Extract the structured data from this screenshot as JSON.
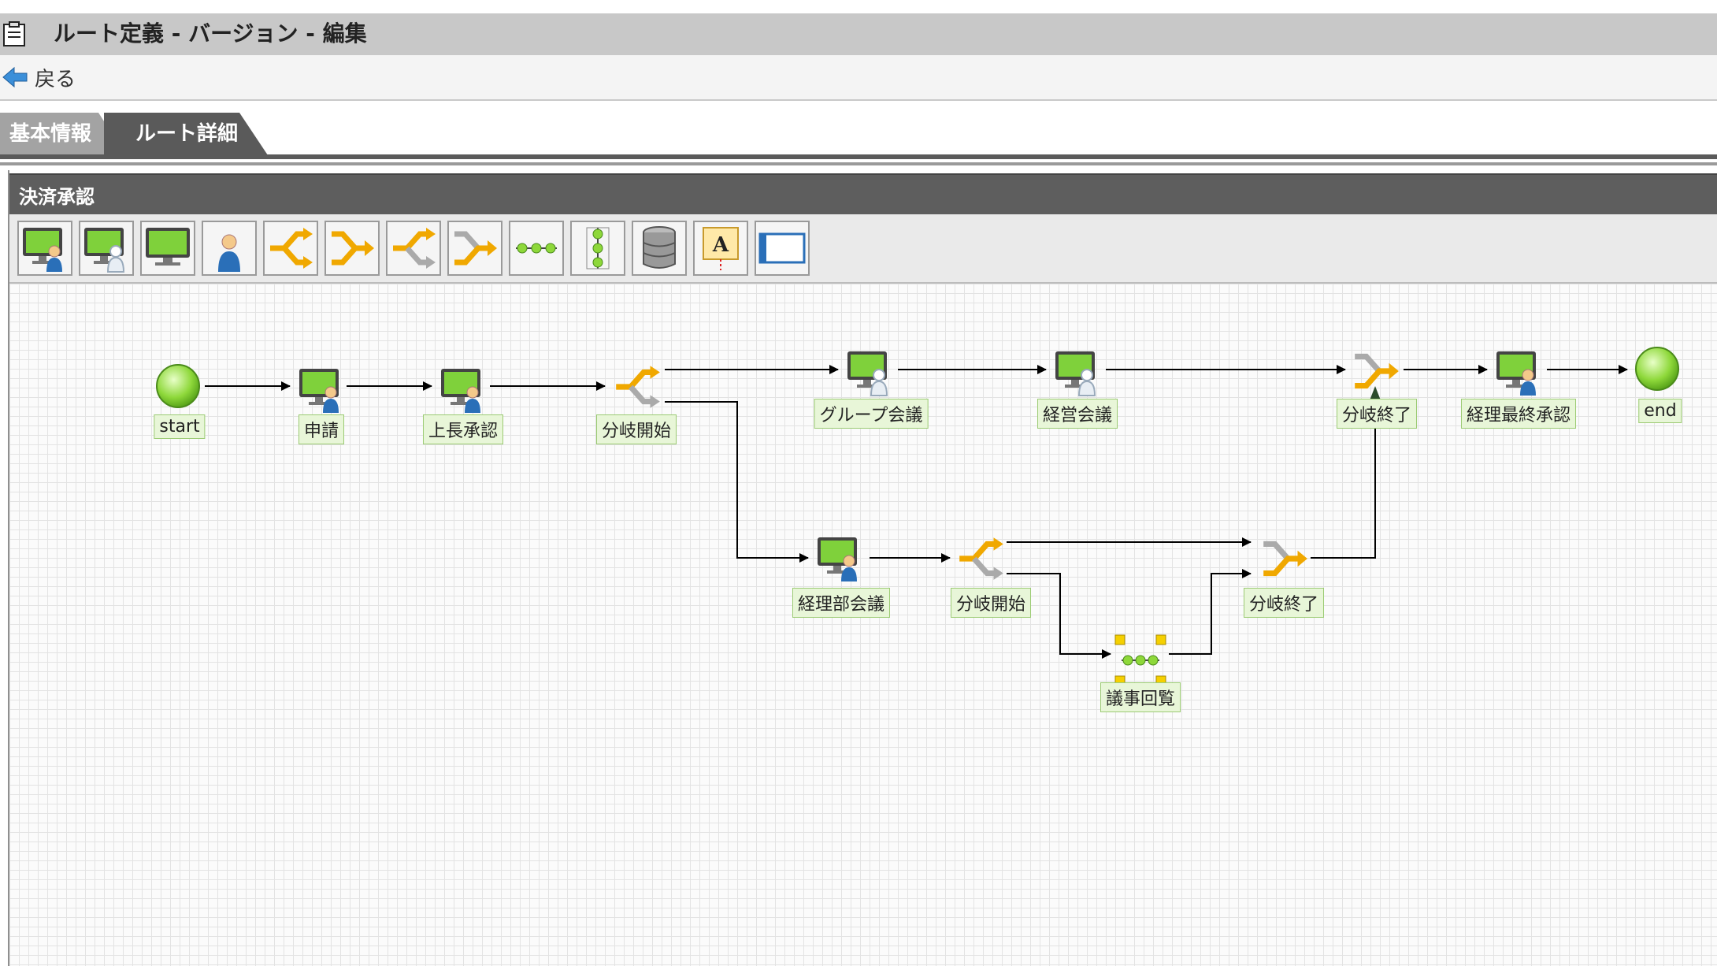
{
  "window": {
    "title": "ルート定義 - バージョン - 編集"
  },
  "nav": {
    "back_label": "戻る"
  },
  "tabs": [
    {
      "label": "基本情報"
    },
    {
      "label": "ルート詳細"
    }
  ],
  "panel": {
    "title": "決済承認"
  },
  "toolbar": {
    "tools": [
      {
        "icon": "user-task-icon"
      },
      {
        "icon": "group-task-icon"
      },
      {
        "icon": "system-task-icon"
      },
      {
        "icon": "person-icon"
      },
      {
        "icon": "branch-start-icon"
      },
      {
        "icon": "branch-end-icon"
      },
      {
        "icon": "branch-start-gray-icon"
      },
      {
        "icon": "branch-end-gray-icon"
      },
      {
        "icon": "horizontal-join-icon"
      },
      {
        "icon": "vertical-join-icon"
      },
      {
        "icon": "database-icon"
      },
      {
        "icon": "text-annotation-icon"
      },
      {
        "icon": "window-icon"
      }
    ]
  },
  "diagram": {
    "nodes": [
      {
        "id": "start",
        "label": "start"
      },
      {
        "id": "apply",
        "label": "申請"
      },
      {
        "id": "boss",
        "label": "上長承認"
      },
      {
        "id": "fork1",
        "label": "分岐開始"
      },
      {
        "id": "group",
        "label": "グループ会議"
      },
      {
        "id": "mgmt",
        "label": "経営会議"
      },
      {
        "id": "join1",
        "label": "分岐終了"
      },
      {
        "id": "final",
        "label": "経理最終承認"
      },
      {
        "id": "end",
        "label": "end"
      },
      {
        "id": "acct",
        "label": "経理部会議"
      },
      {
        "id": "fork2",
        "label": "分岐開始"
      },
      {
        "id": "minutes",
        "label": "議事回覧"
      },
      {
        "id": "join2",
        "label": "分岐終了"
      }
    ]
  },
  "colors": {
    "accent": "#f0a800",
    "node_green": "#8ed83a",
    "label_bg": "#e8f6d8"
  }
}
